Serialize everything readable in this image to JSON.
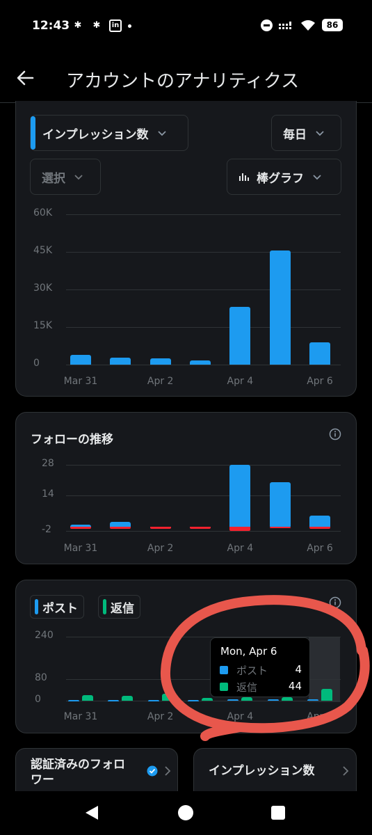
{
  "status_bar": {
    "time": "12:43",
    "battery": "86",
    "left_icons": [
      "slack-icon",
      "slack-icon",
      "linkedin-icon",
      "notification-dot-icon"
    ],
    "right_icons": [
      "do-not-disturb-icon",
      "signal-icon",
      "wifi-icon",
      "battery-icon"
    ]
  },
  "header": {
    "title": "アカウントのアナリティクス",
    "back_icon": "arrow-left-icon"
  },
  "impressions_card": {
    "metric_select": "インプレッション数",
    "interval_select": "毎日",
    "compare_select": "選択",
    "chart_type_select": "棒グラフ",
    "colors": {
      "bar": "#1d9bf0",
      "accent": "#1d9bf0"
    }
  },
  "follows_card": {
    "title": "フォローの推移",
    "colors": {
      "gain": "#1d9bf0",
      "loss": "#f4212e"
    }
  },
  "posts_card": {
    "legend_posts": "ポスト",
    "legend_replies": "返信",
    "colors": {
      "posts": "#1d9bf0",
      "replies": "#00ba7c"
    },
    "tooltip": {
      "title": "Mon, Apr 6",
      "rows": [
        {
          "label": "ポスト",
          "value": "4"
        },
        {
          "label": "返信",
          "value": "44"
        }
      ]
    }
  },
  "bottom_cards": {
    "verified_followers": "認証済みのフォロワー",
    "impressions": "インプレッション数"
  },
  "chart_data": [
    {
      "type": "bar",
      "title": "",
      "xlabel": "",
      "ylabel": "",
      "x_tick_labels": [
        "Mar 31",
        "Apr 2",
        "Apr 4",
        "Apr 6"
      ],
      "y_tick_labels": [
        "0",
        "15K",
        "30K",
        "45K",
        "60K"
      ],
      "ylim": [
        0,
        60000
      ],
      "grid": true,
      "categories": [
        "Mar 31",
        "Apr 1",
        "Apr 2",
        "Apr 3",
        "Apr 4",
        "Apr 5",
        "Apr 6"
      ],
      "values": [
        3800,
        2800,
        2400,
        1800,
        23000,
        45500,
        9000
      ]
    },
    {
      "type": "bar",
      "title": "フォローの推移",
      "xlabel": "",
      "ylabel": "",
      "x_tick_labels": [
        "Mar 31",
        "Apr 2",
        "Apr 4",
        "Apr 6"
      ],
      "y_tick_labels": [
        "-2",
        "14",
        "28"
      ],
      "ylim": [
        -2,
        28
      ],
      "grid": true,
      "categories": [
        "Mar 31",
        "Apr 1",
        "Apr 2",
        "Apr 3",
        "Apr 4",
        "Apr 5",
        "Apr 6"
      ],
      "series": [
        {
          "name": "",
          "values": [
            1,
            2,
            0,
            0,
            28,
            20,
            5
          ]
        },
        {
          "name": "",
          "values": [
            -1,
            -1,
            -1,
            -1,
            -2,
            0,
            -1
          ]
        }
      ]
    },
    {
      "type": "bar",
      "title": "",
      "xlabel": "",
      "ylabel": "",
      "x_tick_labels": [
        "Mar 31",
        "Apr 2",
        "Apr 4",
        "Apr 6"
      ],
      "y_tick_labels": [
        "0",
        "80",
        "240"
      ],
      "ylim": [
        0,
        240
      ],
      "grid": true,
      "categories": [
        "Mar 31",
        "Apr 1",
        "Apr 2",
        "Apr 3",
        "Apr 4",
        "Apr 5",
        "Apr 6"
      ],
      "series": [
        {
          "name": "ポスト",
          "values": [
            2,
            2,
            2,
            2,
            4,
            4,
            4
          ]
        },
        {
          "name": "返信",
          "values": [
            22,
            18,
            26,
            10,
            12,
            14,
            44
          ]
        }
      ]
    }
  ]
}
